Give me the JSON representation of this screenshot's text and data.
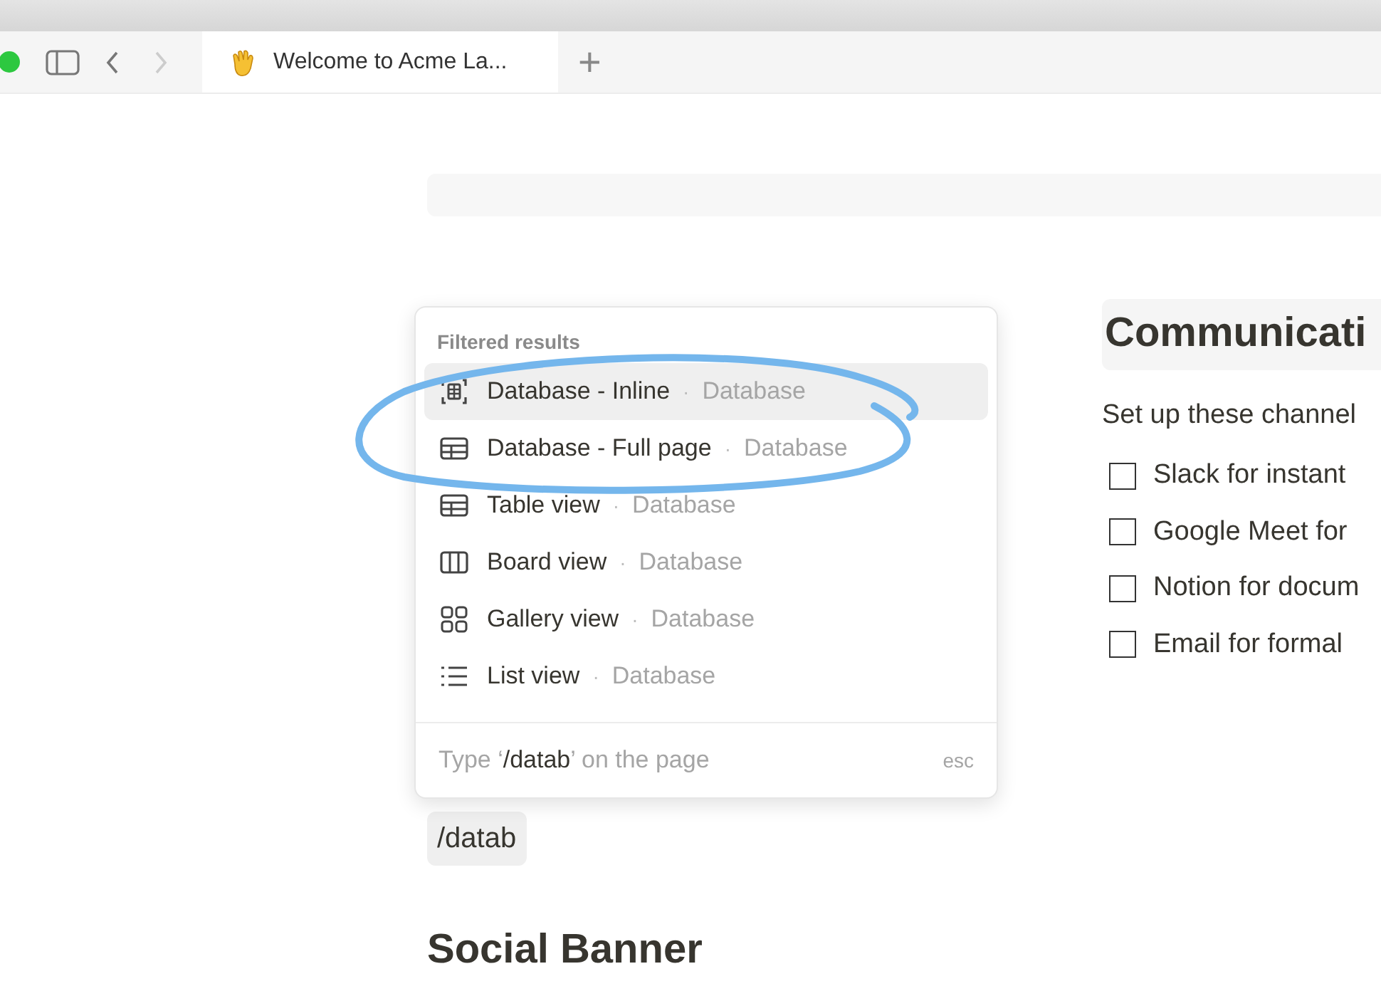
{
  "tab_bar": {
    "tabs": [
      {
        "title": "Welcome to Acme La...",
        "selected": true
      }
    ],
    "new_tab": "+"
  },
  "slash_menu": {
    "heading": "Filtered results",
    "items": [
      {
        "kind": "inline",
        "label": "Database - Inline",
        "group": "Database",
        "selected": true
      },
      {
        "kind": "table",
        "label": "Database - Full page",
        "group": "Database",
        "selected": false
      },
      {
        "kind": "table",
        "label": "Table view",
        "group": "Database",
        "selected": false
      },
      {
        "kind": "board",
        "label": "Board view",
        "group": "Database",
        "selected": false
      },
      {
        "kind": "gallery",
        "label": "Gallery view",
        "group": "Database",
        "selected": false
      },
      {
        "kind": "list",
        "label": "List view",
        "group": "Database",
        "selected": false
      }
    ],
    "separator": "·",
    "footer_hint": "Type ‘**/datab**’ on the page",
    "footer_key": "esc"
  },
  "typed_command": "/datab",
  "section_heading": "Social Banner",
  "right_column": {
    "heading": "Communicati",
    "intro": "Set up these channel",
    "todos": [
      {
        "text": "Slack for instant",
        "checked": false
      },
      {
        "text": "Google Meet for",
        "checked": false
      },
      {
        "text": "Notion for docum",
        "checked": false
      },
      {
        "text": "Email for formal",
        "checked": false
      }
    ]
  }
}
